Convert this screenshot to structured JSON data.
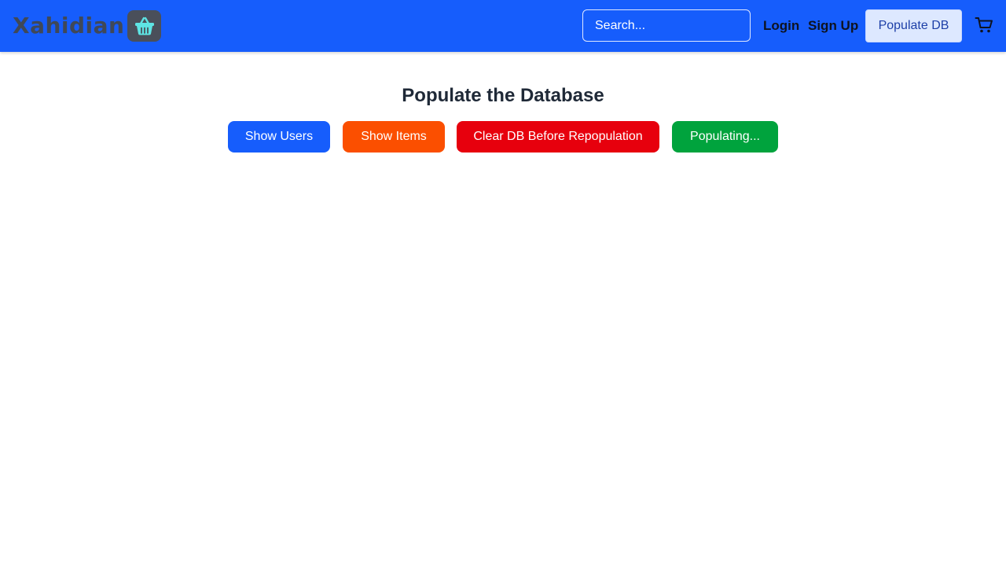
{
  "header": {
    "brand_text": "Xahidian",
    "search": {
      "placeholder": "Search...",
      "value": ""
    },
    "login_label": "Login",
    "signup_label": "Sign Up",
    "populate_label": "Populate DB",
    "cart_icon": "cart-icon",
    "brand_icon": "basket-icon"
  },
  "main": {
    "title": "Populate the Database",
    "buttons": {
      "show_users": "Show Users",
      "show_items": "Show Items",
      "clear_db": "Clear DB Before Repopulation",
      "populating": "Populating..."
    }
  },
  "colors": {
    "navbar": "#165dfc",
    "show_users": "#165dfc",
    "show_items": "#fb4f00",
    "clear_db": "#e7000d",
    "populating": "#00a33d",
    "basket": "#5ee4e4"
  }
}
